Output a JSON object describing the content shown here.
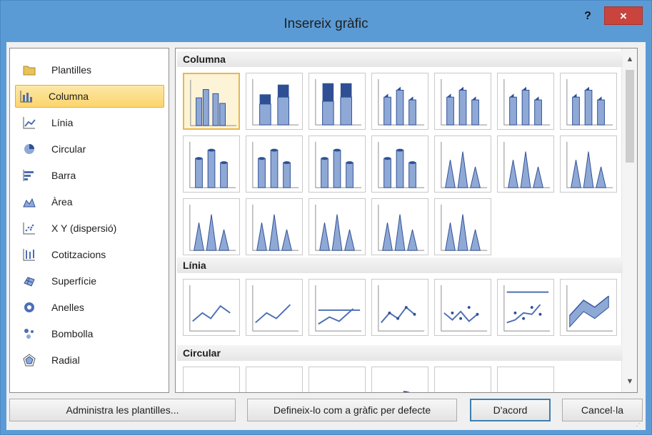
{
  "window": {
    "title": "Insereix gràfic",
    "help_label": "?",
    "close_label": "×"
  },
  "categories": [
    {
      "label": "Plantilles",
      "icon": "folder-icon"
    },
    {
      "label": "Columna",
      "icon": "column-chart-icon",
      "selected": true
    },
    {
      "label": "Línia",
      "icon": "line-chart-icon"
    },
    {
      "label": "Circular",
      "icon": "pie-chart-icon"
    },
    {
      "label": "Barra",
      "icon": "bar-chart-icon"
    },
    {
      "label": "Àrea",
      "icon": "area-chart-icon"
    },
    {
      "label": "X Y (dispersió)",
      "icon": "scatter-chart-icon"
    },
    {
      "label": "Cotitzacions",
      "icon": "stock-chart-icon"
    },
    {
      "label": "Superfície",
      "icon": "surface-chart-icon"
    },
    {
      "label": "Anelles",
      "icon": "doughnut-chart-icon"
    },
    {
      "label": "Bombolla",
      "icon": "bubble-chart-icon"
    },
    {
      "label": "Radial",
      "icon": "radar-chart-icon"
    }
  ],
  "gallery": {
    "sections": [
      {
        "title": "Columna",
        "thumb_count": 19,
        "selected_index": 0
      },
      {
        "title": "Línia",
        "thumb_count": 7
      },
      {
        "title": "Circular",
        "thumb_count": 6
      }
    ]
  },
  "buttons": {
    "manage_templates": "Administra les plantilles...",
    "set_default": "Defineix-lo com a gràfic per defecte",
    "ok": "D'acord",
    "cancel": "Cancel·la"
  },
  "colors": {
    "titlebar": "#5b9bd5",
    "close": "#c9443c",
    "selection": "#fbd46c",
    "chart_blue": "#4d6fb5"
  }
}
